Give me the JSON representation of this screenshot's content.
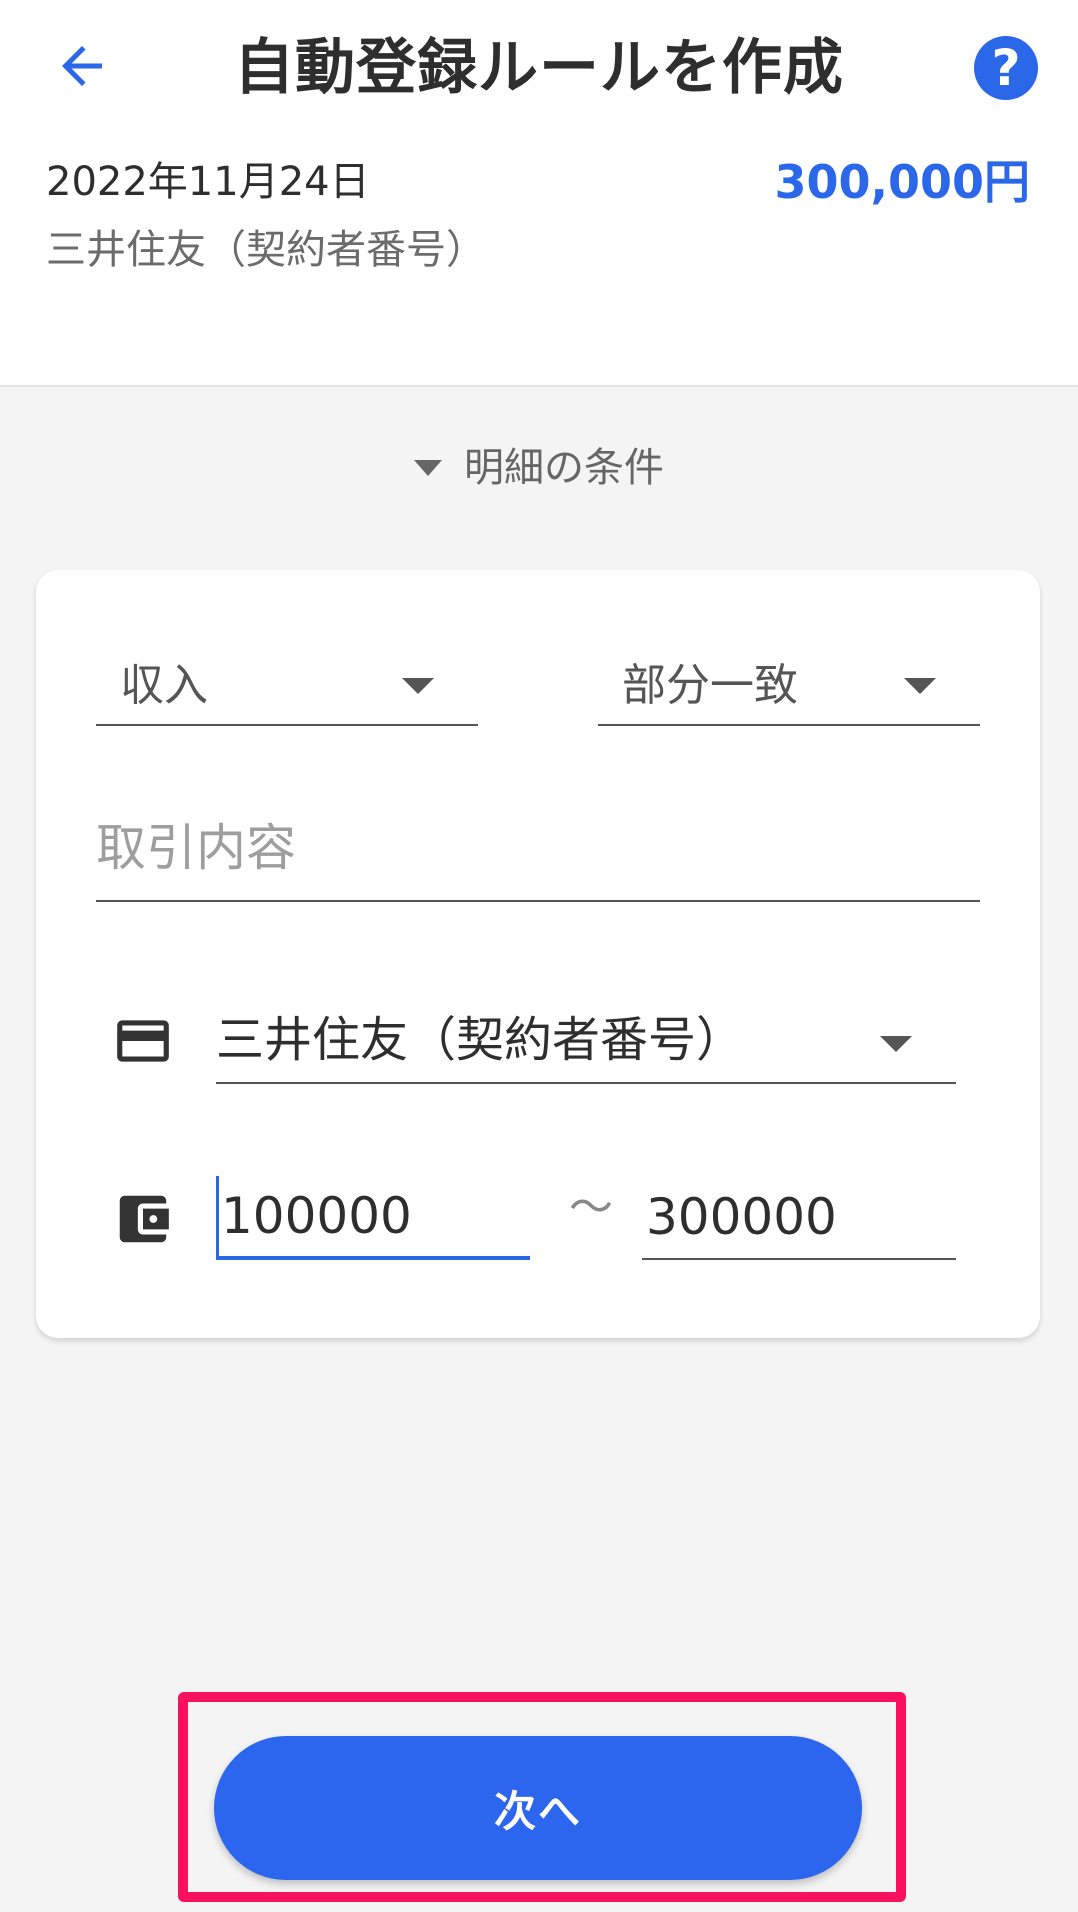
{
  "header": {
    "title": "自動登録ルールを作成",
    "help_label": "?",
    "date": "2022年11月24日",
    "account_name": "三井住友（契約者番号）",
    "amount": "300,000円"
  },
  "conditions": {
    "section_label": "明細の条件",
    "type_value": "収入",
    "match_value": "部分一致",
    "content_placeholder": "取引内容",
    "account_value": "三井住友（契約者番号）",
    "amount_min": "100000",
    "range_separator": "〜",
    "amount_max": "300000"
  },
  "footer": {
    "next_label": "次へ"
  },
  "colors": {
    "accent": "#2b67e9",
    "highlight_frame": "#f9105f"
  },
  "icons": {
    "back": "arrow-left-icon",
    "help": "question-mark-icon",
    "section_toggle": "triangle-down-icon",
    "account": "credit-card-icon",
    "amount": "wallet-icon"
  }
}
